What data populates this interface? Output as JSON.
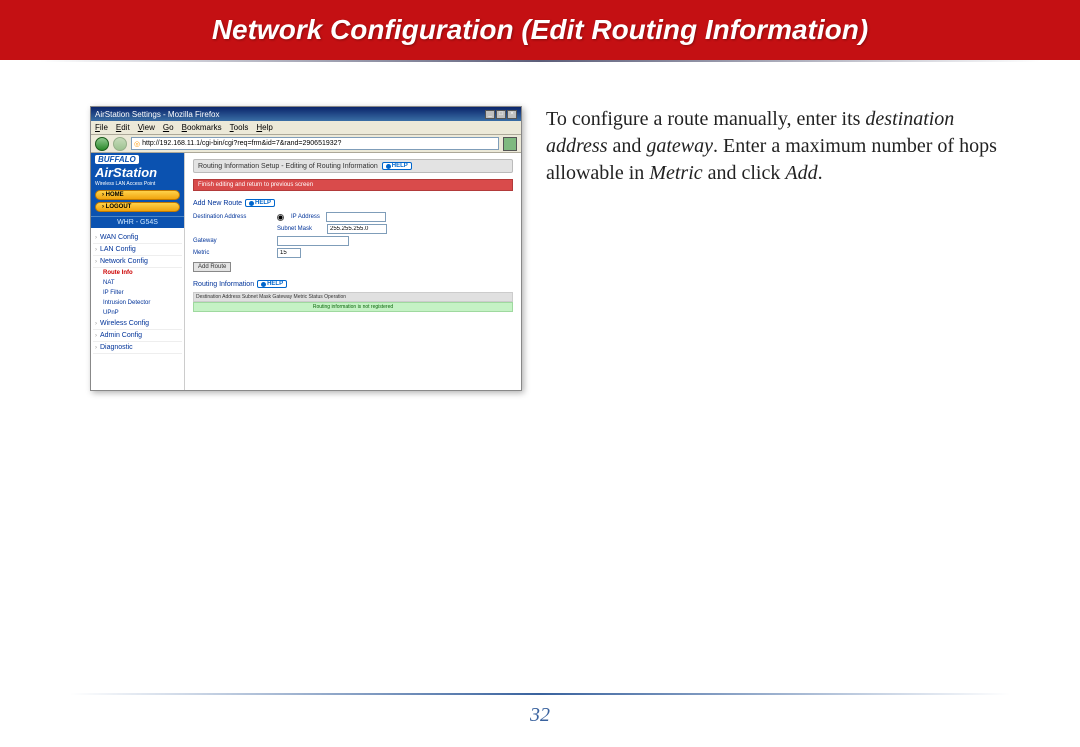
{
  "header": {
    "title": "Network Configuration (Edit Routing Information)"
  },
  "instruction": {
    "p1a": "To configure a route manually, enter its ",
    "p1b": "destination address",
    "p1c": " and ",
    "p1d": "gateway",
    "p1e": ".  Enter a maximum number of hops allowable in ",
    "p1f": "Metric",
    "p1g": " and click ",
    "p1h": "Add",
    "p1i": "."
  },
  "page_number": "32",
  "screenshot": {
    "window_title": "AirStation Settings - Mozilla Firefox",
    "menu": [
      "File",
      "Edit",
      "View",
      "Go",
      "Bookmarks",
      "Tools",
      "Help"
    ],
    "url": "http://192.168.11.1/cgi-bin/cgi?req=frm&id=7&rand=290651932?",
    "brand_top": "BUFFALO",
    "brand_main": "AirStation",
    "brand_sub": "Wireless LAN Access Point",
    "pill_home": "› HOME",
    "pill_logout": "› LOGOUT",
    "model": "WHR - G54S",
    "nav": {
      "items": [
        "WAN Config",
        "LAN Config",
        "Network Config"
      ],
      "sub": [
        "Route Info",
        "NAT",
        "IP Filter",
        "Intrusion Detector",
        "UPnP"
      ],
      "items2": [
        "Wireless Config",
        "Admin Config",
        "Diagnostic"
      ]
    },
    "crumb": "Routing Information Setup - Editing of Routing Information",
    "help": "HELP",
    "red_strip": "Finish editing and return to previous screen",
    "add_label": "Add New Route",
    "form": {
      "dest_lbl": "Destination Address",
      "radio_ip": "IP Address",
      "subnet_lbl": "Subnet Mask",
      "subnet_val": "255.255.255.0",
      "gateway_lbl": "Gateway",
      "metric_lbl": "Metric",
      "metric_val": "15",
      "add_btn": "Add Route"
    },
    "routing_info_label": "Routing Information",
    "table_header": "Destination Address Subnet Mask Gateway Metric Status Operation",
    "table_msg": "Routing information is not registered"
  }
}
